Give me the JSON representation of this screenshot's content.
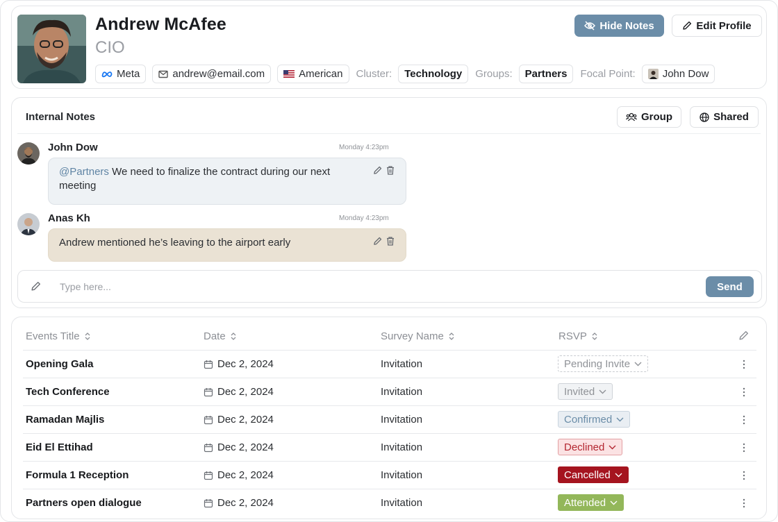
{
  "profile": {
    "name": "Andrew McAfee",
    "role": "CIO",
    "company": "Meta",
    "email": "andrew@email.com",
    "nationality": "American",
    "cluster_label": "Cluster:",
    "cluster_value": "Technology",
    "groups_label": "Groups:",
    "groups_value": "Partners",
    "focal_label": "Focal Point:",
    "focal_value": "John Dow",
    "hide_notes_label": "Hide Notes",
    "edit_profile_label": "Edit Profile"
  },
  "notes": {
    "title": "Internal Notes",
    "group_label": "Group",
    "shared_label": "Shared",
    "messages": [
      {
        "author": "John Dow",
        "time": "Monday 4:23pm",
        "mention": "@Partners",
        "text": " We need to finalize the contract during our next meeting"
      },
      {
        "author": "Anas Kh",
        "time": "Monday 4:23pm",
        "mention": "",
        "text": "Andrew mentioned he’s leaving to the airport early"
      }
    ],
    "composer_placeholder": "Type here...",
    "send_label": "Send"
  },
  "events": {
    "columns": [
      "Events Title",
      "Date",
      "Survey Name",
      "RSVP"
    ],
    "rows": [
      {
        "title": "Opening Gala",
        "date": "Dec 2, 2024",
        "survey": "Invitation",
        "rsvp": "Pending Invite"
      },
      {
        "title": "Tech Conference",
        "date": "Dec 2, 2024",
        "survey": "Invitation",
        "rsvp": "Invited"
      },
      {
        "title": "Ramadan Majlis",
        "date": "Dec 2, 2024",
        "survey": "Invitation",
        "rsvp": "Confirmed"
      },
      {
        "title": "Eid El Ettihad",
        "date": "Dec 2, 2024",
        "survey": "Invitation",
        "rsvp": "Declined"
      },
      {
        "title": "Formula 1 Reception",
        "date": "Dec 2, 2024",
        "survey": "Invitation",
        "rsvp": "Cancelled"
      },
      {
        "title": "Partners open dialogue",
        "date": "Dec 2, 2024",
        "survey": "Invitation",
        "rsvp": "Attended"
      }
    ]
  },
  "colors": {
    "accent": "#6b8da8",
    "declined": "#b32630",
    "cancelled": "#a5141f",
    "attended": "#93b75a"
  }
}
